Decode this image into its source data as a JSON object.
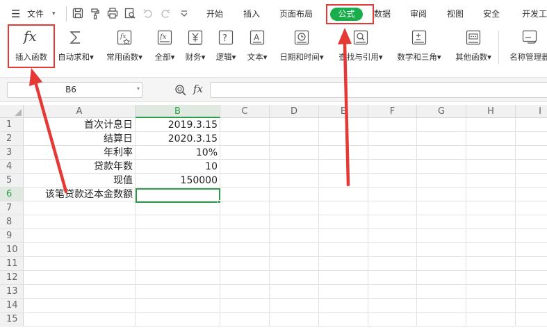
{
  "menubar": {
    "menu_icon": "☰",
    "file_label": "文件",
    "file_caret": "▾",
    "quick_access": [
      "save-icon",
      "format-painter-icon",
      "print-icon",
      "print-preview-icon",
      "undo-icon",
      "redo-icon",
      "customize-caret-icon"
    ],
    "tabs": [
      {
        "id": "start",
        "label": "开始"
      },
      {
        "id": "insert",
        "label": "插入"
      },
      {
        "id": "layout",
        "label": "页面布局"
      },
      {
        "id": "formula",
        "label": "公式",
        "active": true
      },
      {
        "id": "data",
        "label": "数据"
      },
      {
        "id": "review",
        "label": "审阅"
      },
      {
        "id": "view",
        "label": "视图"
      },
      {
        "id": "security",
        "label": "安全"
      },
      {
        "id": "dev",
        "label": "开发工"
      }
    ],
    "active_tab_color": "#1aad4b"
  },
  "ribbon": {
    "buttons": [
      {
        "id": "insert-function",
        "label": "插入函数",
        "icon": "fx-icon"
      },
      {
        "id": "autosum",
        "label": "自动求和▾",
        "icon": "sigma-icon"
      },
      {
        "id": "common-functions",
        "label": "常用函数▾",
        "icon": "star-function-icon"
      },
      {
        "id": "all-functions",
        "label": "全部▾",
        "icon": "function-list-icon"
      },
      {
        "id": "financial",
        "label": "财务▾",
        "icon": "yen-icon"
      },
      {
        "id": "logical",
        "label": "逻辑▾",
        "icon": "question-icon"
      },
      {
        "id": "text",
        "label": "文本▾",
        "icon": "text-a-icon"
      },
      {
        "id": "datetime",
        "label": "日期和时间▾",
        "icon": "clock-icon"
      },
      {
        "id": "lookup",
        "label": "查找与引用▾",
        "icon": "magnifier-book-icon"
      },
      {
        "id": "math-trig",
        "label": "数学和三角▾",
        "icon": "plus-minus-icon"
      },
      {
        "id": "other-functions",
        "label": "其他函数▾",
        "icon": "ellipsis-book-icon"
      },
      {
        "id": "name-manager",
        "label": "名称管理器",
        "icon": "name-manager-icon"
      }
    ]
  },
  "formula_bar": {
    "name_box": "B6",
    "name_box_caret": "▾",
    "fx": "fx",
    "formula": ""
  },
  "sheet": {
    "columns": [
      "A",
      "B",
      "C",
      "D",
      "E",
      "F",
      "G",
      "H",
      "I"
    ],
    "selected_column": "B",
    "rows": [
      "1",
      "2",
      "3",
      "4",
      "5",
      "6",
      "7",
      "8",
      "9",
      "10",
      "11",
      "12",
      "13",
      "14",
      "15"
    ],
    "selected_row": "6",
    "cells": [
      {
        "label": "首次计息日",
        "value": "2019.3.15"
      },
      {
        "label": "结算日",
        "value": "2020.3.15"
      },
      {
        "label": "年利率",
        "value": "10%"
      },
      {
        "label": "贷款年数",
        "value": "10"
      },
      {
        "label": "现值",
        "value": "150000"
      },
      {
        "label": "该笔贷款还本金数额",
        "value": ""
      }
    ],
    "active_cell": "B6",
    "selection_color": "#2e9b4b"
  },
  "annotations": {
    "highlight_color": "#e53935",
    "highlighted": [
      "公式",
      "插入函数"
    ]
  }
}
